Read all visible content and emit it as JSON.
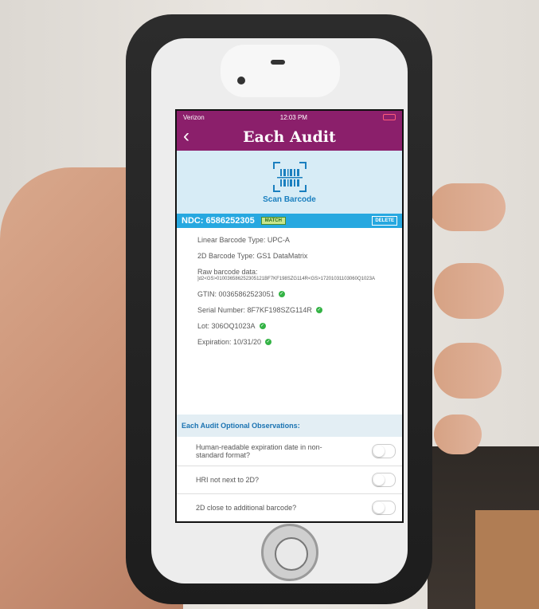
{
  "status_bar": {
    "carrier": "Verizon",
    "time": "12:03 PM"
  },
  "nav": {
    "back": "‹",
    "title": "Each Audit"
  },
  "scan": {
    "label": "Scan Barcode"
  },
  "ndc_bar": {
    "ndc": "NDC: 6586252305",
    "match": "MATCH",
    "delete": "DELETE"
  },
  "details": {
    "linear_type": "Linear Barcode Type: UPC-A",
    "twod_type": "2D Barcode Type: GS1 DataMatrix",
    "raw_label": "Raw barcode data:",
    "raw_value": "]d2<GS>010036586252305121BF7KF198SZG114R<GS>17201031103060Q1023A",
    "gtin": "GTIN: 00365862523051",
    "serial": "Serial Number: 8F7KF198SZG114R",
    "lot": "Lot: 306OQ1023A",
    "expiration": "Expiration: 10/31/20"
  },
  "observations": {
    "title": "Each Audit Optional Observations:",
    "items": [
      "Human-readable expiration date in non-standard format?",
      "HRI not next to 2D?",
      "2D close to additional barcode?"
    ]
  },
  "colors": {
    "header": "#8b1f6b",
    "ndc_bar": "#27a8e0",
    "check": "#34b345"
  }
}
